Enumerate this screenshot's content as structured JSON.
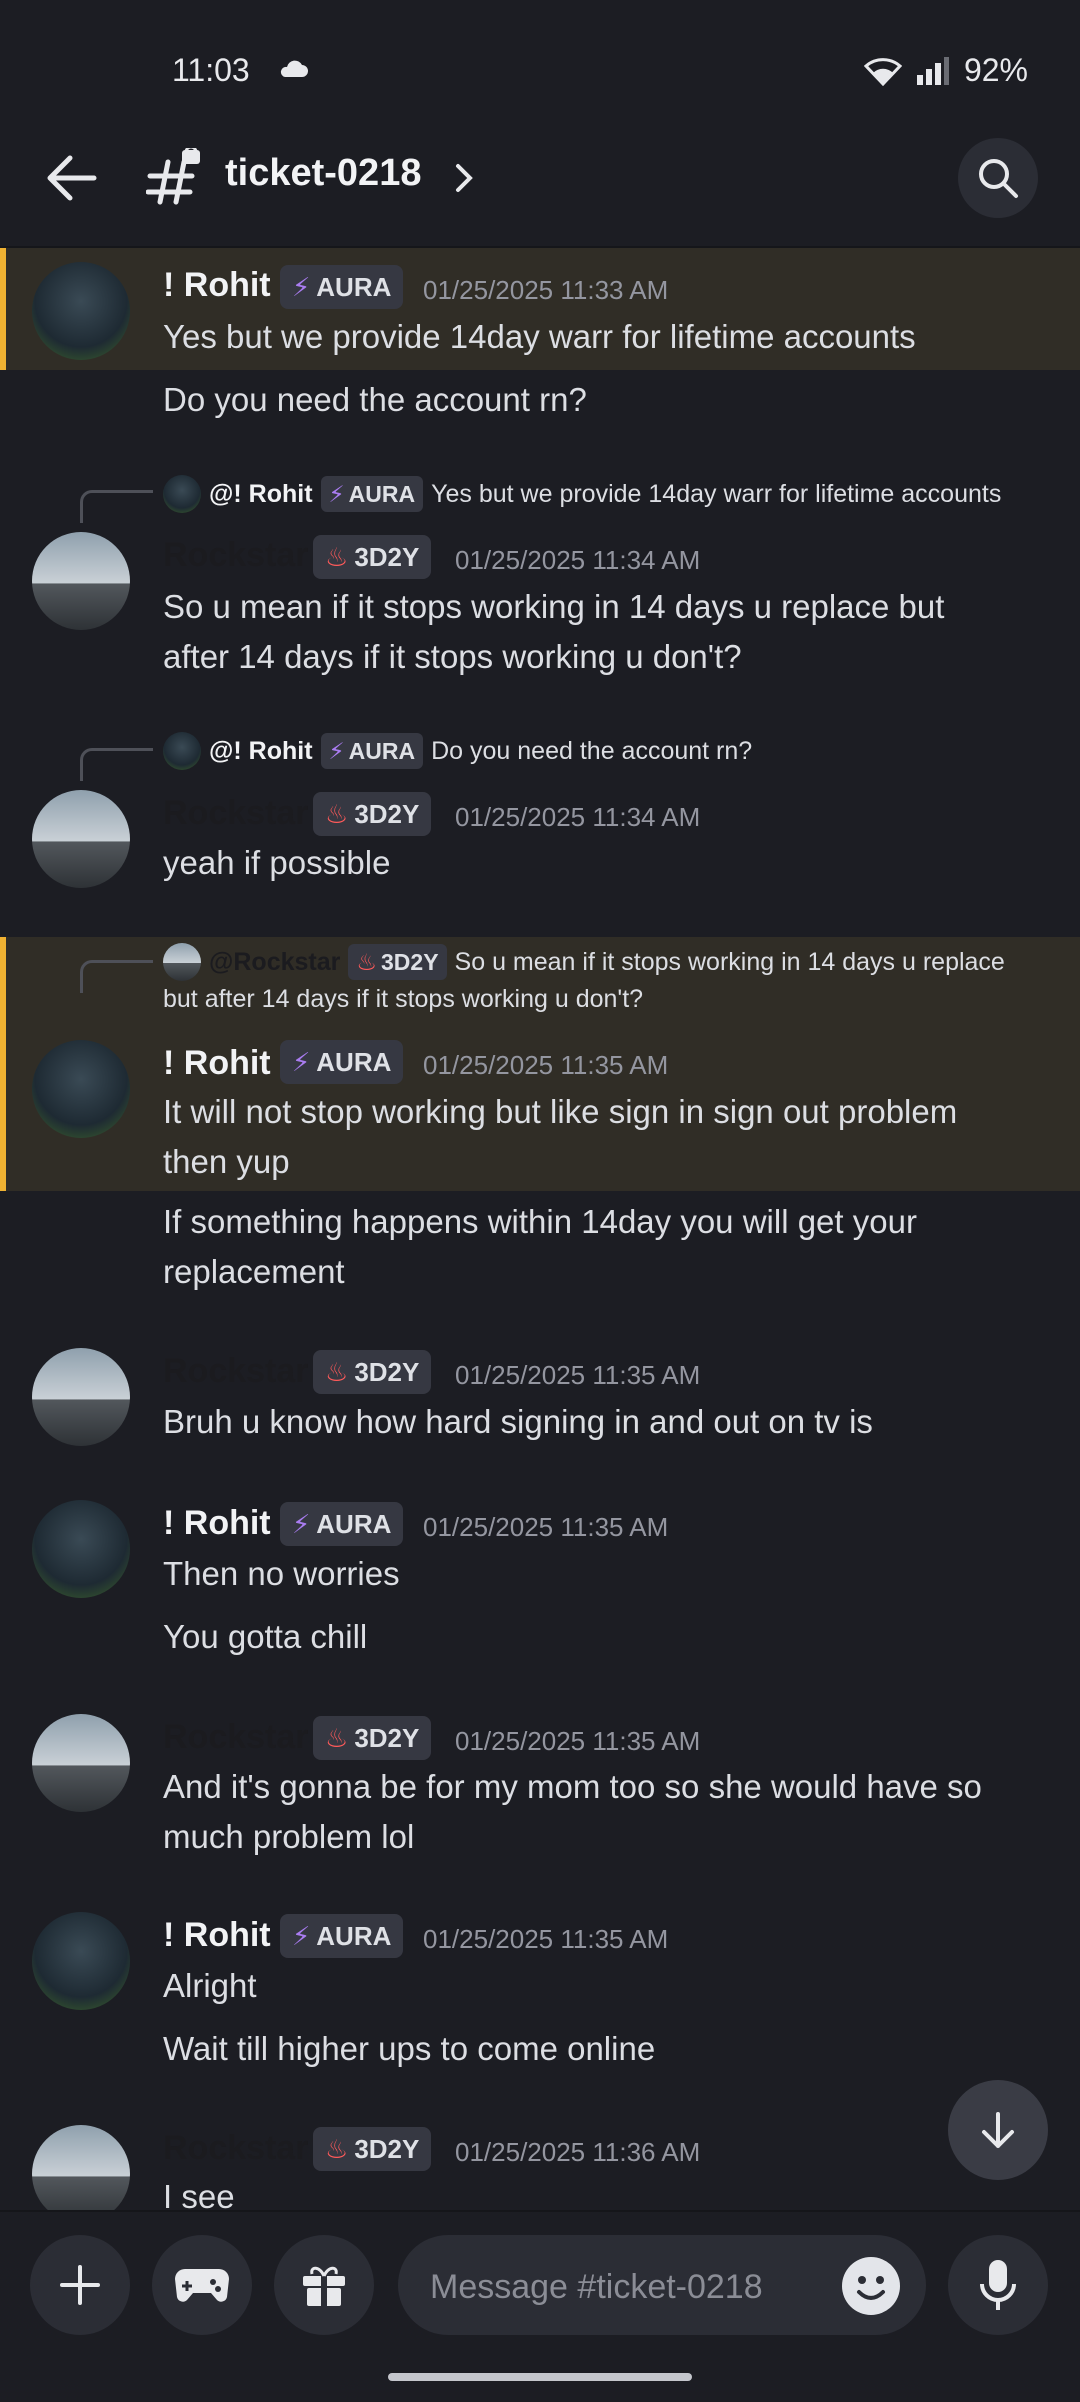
{
  "status_bar": {
    "time": "11:03",
    "battery": "92%"
  },
  "header": {
    "channel": "ticket-0218"
  },
  "tags": {
    "aura": "AURA",
    "rock": "3D2Y"
  },
  "messages": [
    {
      "name": "! Rohit",
      "time": "01/25/2025 11:33 AM",
      "lines": [
        "Yes but we provide 14day warr for lifetime accounts"
      ]
    },
    {
      "text": "Do you need the account rn?"
    },
    {
      "reply_name": "@! Rohit",
      "reply_text": "Yes but we provide 14day warr for lifetime accounts",
      "name": "Rockstar",
      "time": "01/25/2025 11:34 AM",
      "lines": [
        "So u mean if it stops working in 14 days u replace but",
        "after 14 days if it stops working u don't?"
      ]
    },
    {
      "reply_name": "@! Rohit",
      "reply_text": "Do you need the account rn?",
      "name": "Rockstar",
      "time": "01/25/2025 11:34 AM",
      "lines": [
        "yeah if possible"
      ]
    },
    {
      "reply_name": "@Rockstar",
      "reply_text_1": "So u mean if it stops working in 14 days u replace",
      "reply_text_2": "but after 14 days if it stops working u don't?",
      "name": "! Rohit",
      "time": "01/25/2025 11:35 AM",
      "lines": [
        "It will not stop working but like sign in sign out problem",
        "then yup"
      ]
    },
    {
      "lines": [
        "If something happens within 14day you will get your",
        "replacement"
      ]
    },
    {
      "name": "Rockstar",
      "time": "01/25/2025 11:35 AM",
      "lines": [
        "Bruh u know how hard signing in and out on tv is"
      ]
    },
    {
      "name": "! Rohit",
      "time": "01/25/2025 11:35 AM",
      "lines": [
        "Then no worries"
      ]
    },
    {
      "text": "You gotta chill"
    },
    {
      "name": "Rockstar",
      "time": "01/25/2025 11:35 AM",
      "lines": [
        "And it's gonna be for my mom too so she would have so",
        "much problem lol"
      ]
    },
    {
      "name": "! Rohit",
      "time": "01/25/2025 11:35 AM",
      "lines": [
        "Alright"
      ]
    },
    {
      "text": "Wait till higher ups to come online"
    },
    {
      "name": "Rockstar",
      "time": "01/25/2025 11:36 AM",
      "lines": [
        "I see"
      ]
    }
  ],
  "composer": {
    "placeholder": "Message #ticket-0218"
  },
  "colors": {
    "background": "#1c1d23",
    "highlight": "#302d26",
    "highlight_bar": "#f0b232",
    "tag_bg": "#363842"
  }
}
